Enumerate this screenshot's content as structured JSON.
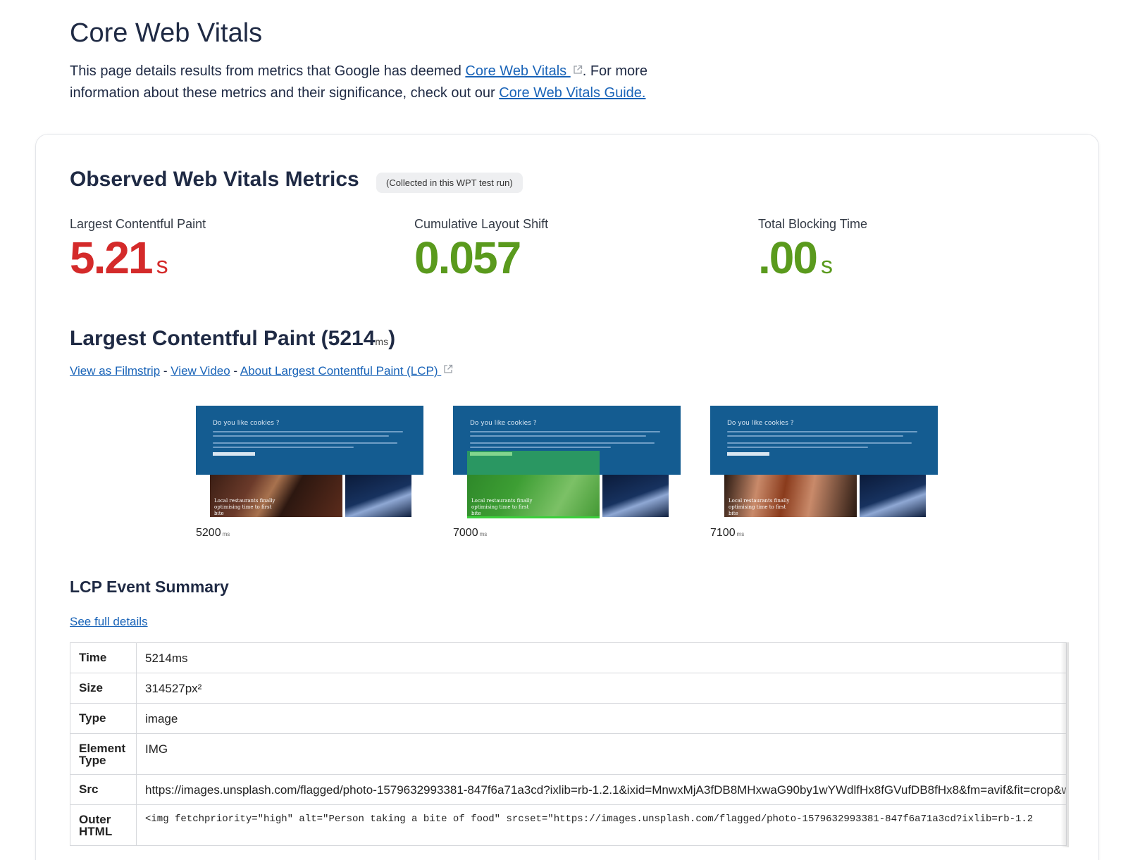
{
  "header": {
    "title": "Core Web Vitals",
    "intro_before_link": "This page details results from metrics that Google has deemed ",
    "intro_link1": "Core Web Vitals ",
    "intro_middle": ". For more information about these metrics and their significance, check out our ",
    "intro_link2": "Core Web Vitals Guide."
  },
  "observed": {
    "title": "Observed Web Vitals Metrics",
    "badge": "(Collected in this WPT test run)",
    "metrics": [
      {
        "label": "Largest Contentful Paint",
        "value": "5.21",
        "unit": "s",
        "status": "poor"
      },
      {
        "label": "Cumulative Layout Shift",
        "value": "0.057",
        "unit": "",
        "status": "good"
      },
      {
        "label": "Total Blocking Time",
        "value": ".00",
        "unit": "s",
        "status": "good"
      }
    ],
    "colors": {
      "poor": "#d42a2a",
      "good": "#5a9a1d"
    }
  },
  "lcp": {
    "title_prefix": "Largest Contentful Paint (5214",
    "title_unit": "ms",
    "title_suffix": ")",
    "link_filmstrip": "View as Filmstrip",
    "sep1": " - ",
    "link_video": "View Video",
    "sep2": " - ",
    "link_about": "About Largest Contentful Paint (LCP) ",
    "frames": [
      {
        "time": "5200",
        "unit": "ms",
        "heading": "Do you like cookies ?",
        "caption": "Local restaurants finally optimising time to first bite",
        "highlighted": false
      },
      {
        "time": "7000",
        "unit": "ms",
        "heading": "Do you like cookies ?",
        "caption": "Local restaurants finally optimising time to first bite",
        "highlighted": true
      },
      {
        "time": "7100",
        "unit": "ms",
        "heading": "Do you like cookies ?",
        "caption": "Local restaurants finally optimising time to first bite",
        "highlighted": false
      }
    ]
  },
  "summary": {
    "title": "LCP Event Summary",
    "full_details": "See full details",
    "rows": [
      {
        "key": "Time",
        "value": "5214ms"
      },
      {
        "key": "Size",
        "value": "314527px²"
      },
      {
        "key": "Type",
        "value": "image"
      },
      {
        "key": "Element Type",
        "value": "IMG"
      },
      {
        "key": "Src",
        "value": "https://images.unsplash.com/flagged/photo-1579632993381-847f6a71a3cd?ixlib=rb-1.2.1&ixid=MnwxMjA3fDB8MHxwaG90by1wYWdlfHx8fGVufDB8fHx8&fm=avif&fit=crop&w"
      },
      {
        "key": "Outer HTML",
        "value": "<img fetchpriority=\"high\" alt=\"Person taking a bite of food\" srcset=\"https://images.unsplash.com/flagged/photo-1579632993381-847f6a71a3cd?ixlib=rb-1.2"
      }
    ]
  }
}
